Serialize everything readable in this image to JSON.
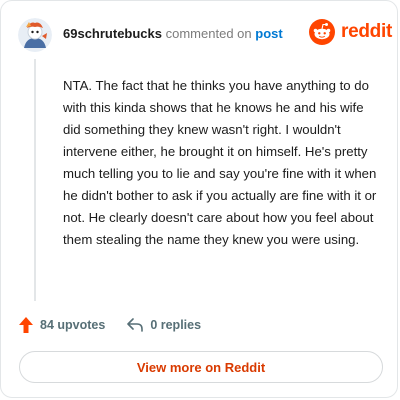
{
  "comment": {
    "username": "69schrutebucks",
    "action_text": "commented on",
    "post_link": "post",
    "body": "NTA. The fact that he thinks you have anything to do with this kinda shows that he knows he and his wife did something they knew wasn't right. I wouldn't intervene either, he brought it on himself. He's pretty much telling you to lie and say you're fine with it when he didn't bother to ask if you actually are fine with it or not. He clearly doesn't care about how you feel about them stealing the name they knew you were using."
  },
  "brand": {
    "name": "reddit",
    "color": "#ff4500"
  },
  "actions": {
    "upvotes": "84 upvotes",
    "replies": "0 replies"
  },
  "cta": {
    "label": "View more on Reddit"
  },
  "icons": {
    "upvote": "upvote-arrow-icon",
    "reply": "reply-arrow-icon",
    "avatar": "user-avatar",
    "logo": "reddit-snoo-logo"
  },
  "colors": {
    "link": "#0079d3",
    "upvote": "#ff4500",
    "cta_text": "#d93a00",
    "muted": "#576f76"
  }
}
